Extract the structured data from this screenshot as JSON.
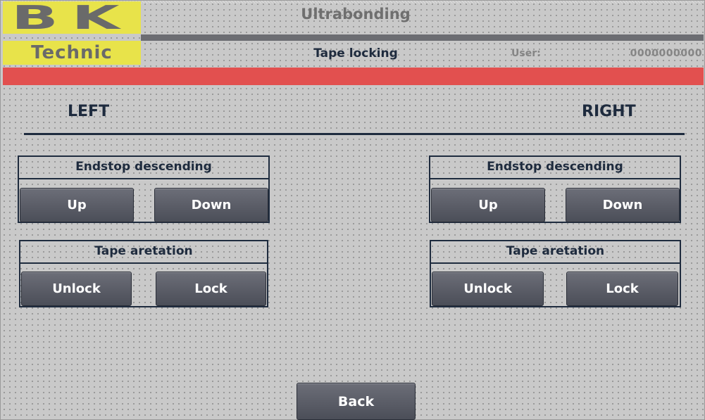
{
  "header": {
    "logo_top": "BK",
    "logo_bottom": "Technic",
    "app_title": "Ultrabonding",
    "screen_title": "Tape locking",
    "user_label": "User:",
    "user_value": "0000000000"
  },
  "colors": {
    "logo_bg": "#e8e34a",
    "alarm_bar": "#e2504f",
    "title_bar": "#6c6d72",
    "text_dark": "#1e2b3e",
    "button": "#5a5d67"
  },
  "sides": {
    "left": {
      "heading": "LEFT",
      "endstop": {
        "title": "Endstop descending",
        "up": "Up",
        "down": "Down"
      },
      "tape": {
        "title": "Tape aretation",
        "unlock": "Unlock",
        "lock": "Lock"
      }
    },
    "right": {
      "heading": "RIGHT",
      "endstop": {
        "title": "Endstop descending",
        "up": "Up",
        "down": "Down"
      },
      "tape": {
        "title": "Tape aretation",
        "unlock": "Unlock",
        "lock": "Lock"
      }
    }
  },
  "footer": {
    "back_label": "Back"
  }
}
